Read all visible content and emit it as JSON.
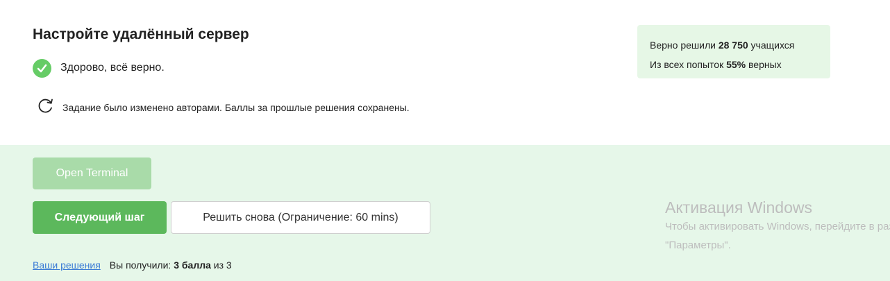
{
  "task": {
    "title": "Настройте удалённый сервер",
    "status_text": "Здорово, всё верно.",
    "notice_text": "Задание было изменено авторами. Баллы за прошлые решения сохранены."
  },
  "stats": {
    "solved_prefix": "Верно решили ",
    "solved_count": "28 750",
    "solved_suffix": " учащихся",
    "attempts_prefix": "Из всех попыток ",
    "attempts_percent": "55%",
    "attempts_suffix": " верных"
  },
  "actions": {
    "open_terminal_label": "Open Terminal",
    "next_step_label": "Следующий шаг",
    "retry_label": "Решить снова (Ограничение: 60 mins)"
  },
  "footer": {
    "solutions_link": "Ваши решения",
    "score_prefix": "Вы получили: ",
    "score_value": "3 балла",
    "score_suffix": " из 3"
  },
  "windows_activation": {
    "title": "Активация Windows",
    "line1": "Чтобы активировать Windows, перейдите в раздел",
    "line2": "\"Параметры\"."
  },
  "colors": {
    "success": "#66cc66",
    "primary_button": "#5cb85c",
    "disabled_button": "#a9dba9",
    "panel_background": "#e6f7e9",
    "link": "#3a7bd5"
  },
  "icons": {
    "status": "check-circle-icon",
    "notice": "refresh-icon"
  }
}
